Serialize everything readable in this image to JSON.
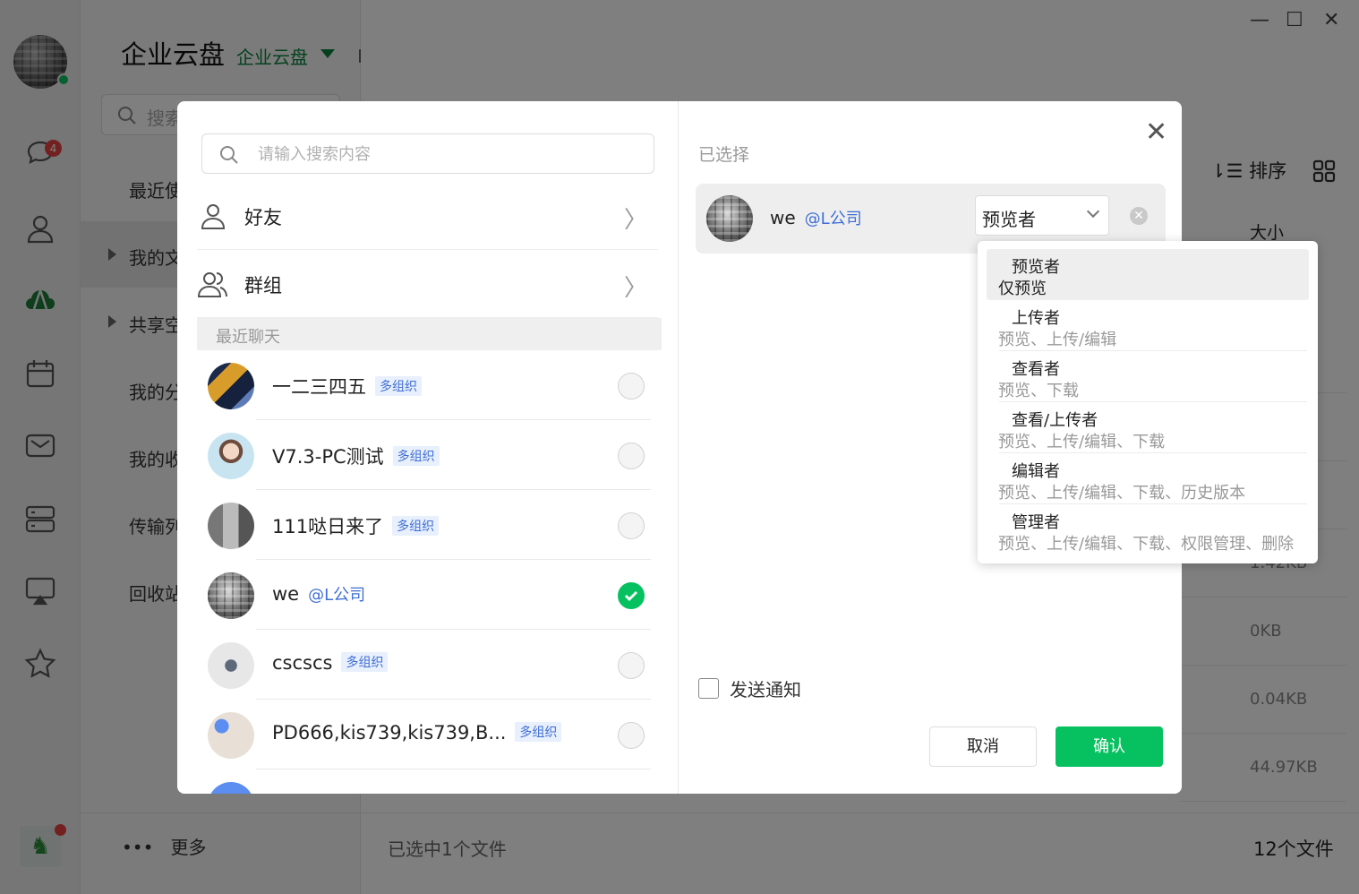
{
  "app": {
    "title": "企业云盘",
    "space": "企业云盘"
  },
  "rail": {
    "chat_badge": "4"
  },
  "sidebar": {
    "search_placeholder": "搜索",
    "items": [
      {
        "label": "最近使"
      },
      {
        "label": "我的文"
      },
      {
        "label": "共享空"
      },
      {
        "label": "我的分"
      },
      {
        "label": "我的收"
      },
      {
        "label": "传输列"
      },
      {
        "label": "回收站"
      }
    ],
    "more": "更多"
  },
  "main": {
    "sort_label": "排序",
    "size_header": "大小",
    "sizes": [
      "1.42KB",
      "0KB",
      "0.04KB",
      "44.97KB"
    ],
    "status": "已选中1个文件",
    "file_count": "12个文件"
  },
  "dialog": {
    "search_placeholder": "请输入搜索内容",
    "friends_label": "好友",
    "groups_label": "群组",
    "recent_label": "最近聊天",
    "contacts": [
      {
        "name": "一二三四五",
        "tag": "多组织",
        "checked": false
      },
      {
        "name": "V7.3-PC测试",
        "tag": "多组织",
        "checked": false
      },
      {
        "name": "111哒日来了",
        "tag": "多组织",
        "checked": false
      },
      {
        "name": "we",
        "org": "@L公司",
        "checked": true
      },
      {
        "name": "cscscs",
        "tag": "多组织",
        "checked": false
      },
      {
        "name": "PD666,kis739,kis739,B...",
        "tag": "多组织",
        "checked": false
      }
    ],
    "selected_title": "已选择",
    "selected": {
      "name": "we",
      "org": "@L公司",
      "role": "预览者"
    },
    "notify_label": "发送通知",
    "cancel_label": "取消",
    "confirm_label": "确认",
    "roles": [
      {
        "title": "预览者",
        "desc": "仅预览"
      },
      {
        "title": "上传者",
        "desc": "预览、上传/编辑"
      },
      {
        "title": "查看者",
        "desc": "预览、下载"
      },
      {
        "title": "查看/上传者",
        "desc": "预览、上传/编辑、下载"
      },
      {
        "title": "编辑者",
        "desc": "预览、上传/编辑、下载、历史版本"
      },
      {
        "title": "管理者",
        "desc": "预览、上传/编辑、下载、权限管理、删除"
      }
    ]
  },
  "colors": {
    "accent": "#07c160",
    "link": "#3f6fd4",
    "badge": "#e64340"
  }
}
